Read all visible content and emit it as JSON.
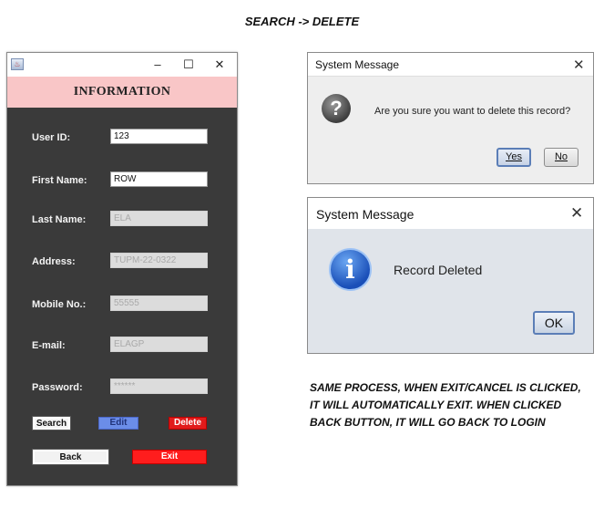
{
  "heading": "SEARCH -> DELETE",
  "form_window": {
    "controls": {
      "minimize": "–",
      "maximize": "☐",
      "close": "✕"
    },
    "banner": "INFORMATION",
    "fields": [
      {
        "label": "User ID:",
        "value": "123"
      },
      {
        "label": "First Name:",
        "value": "ROW"
      },
      {
        "label": "Last Name:",
        "value": "ELA"
      },
      {
        "label": "Address:",
        "value": "TUPM-22-0322"
      },
      {
        "label": "Mobile No.:",
        "value": "55555"
      },
      {
        "label": "E-mail:",
        "value": "ELAGP"
      },
      {
        "label": "Password:",
        "value": "******"
      }
    ],
    "buttons": {
      "search": "Search",
      "edit": "Edit",
      "delete": "Delete",
      "back": "Back",
      "exit": "Exit"
    }
  },
  "confirm_dialog": {
    "title": "System Message",
    "close": "✕",
    "icon": "question-icon",
    "message": "Are you sure you want to delete this record?",
    "yes": "Yes",
    "no": "No"
  },
  "info_dialog": {
    "title": "System Message",
    "close": "✕",
    "icon": "info-icon",
    "message": "Record Deleted",
    "ok": "OK"
  },
  "note_lines": [
    "SAME PROCESS, WHEN EXIT/CANCEL IS CLICKED,",
    "IT WILL AUTOMATICALLY EXIT. WHEN CLICKED",
    "BACK BUTTON, IT WILL GO BACK TO LOGIN"
  ]
}
